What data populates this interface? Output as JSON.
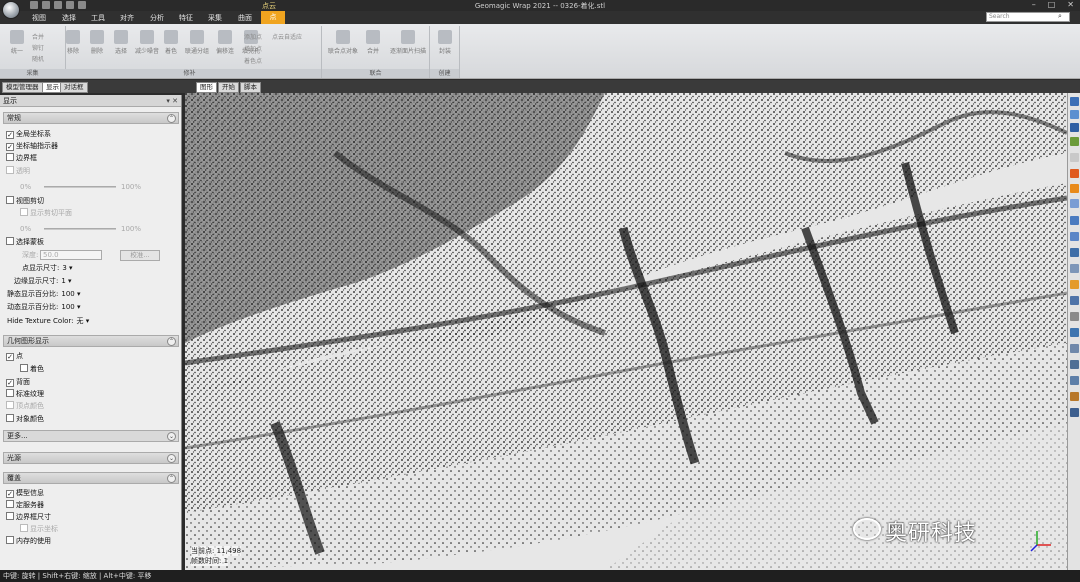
{
  "window": {
    "title": "Geomagic Wrap 2021 -- 0326-着化.stl",
    "context_tab_title": "点云"
  },
  "menu_tabs": [
    "视图",
    "选择",
    "工具",
    "对齐",
    "分析",
    "特征",
    "采集",
    "曲面"
  ],
  "active_tab": "点",
  "search": {
    "placeholder": "Search"
  },
  "ribbon": {
    "group1": {
      "label": "采集",
      "buttons": [
        "统一"
      ],
      "small": [
        "合并",
        "铆钉",
        "随机"
      ]
    },
    "group2": {
      "label": "修补",
      "buttons": [
        "移除",
        "删除",
        "选择",
        "减少噪音",
        "着色",
        "联通分组",
        "偏移连",
        "填充孔"
      ],
      "small": [
        "添加点",
        "增加点",
        "着色点",
        "投影方向",
        "点云自适应"
      ]
    },
    "group3": {
      "label": "联合",
      "buttons": [
        "联合点对象",
        "合并",
        "逐渐面片扫描"
      ]
    },
    "group4": {
      "label": "创建",
      "buttons": [
        "封装"
      ]
    }
  },
  "sub_tabs": [
    "模型管理器",
    "显示",
    "对话框"
  ],
  "viewport_tabs": [
    "图形",
    "开始",
    "脚本"
  ],
  "panel": {
    "title": "显示",
    "sections": {
      "general": {
        "title": "常规"
      },
      "geometry": {
        "title": "几何图形显示"
      },
      "lighting": {
        "title": "光源"
      },
      "overlay": {
        "title": "覆盖"
      }
    },
    "general_items": {
      "global_axes": "全局坐标系",
      "axis_indicator": "坐标轴指示器",
      "bounding_box": "边界框",
      "transparent": "透明",
      "pct_min": "0%",
      "pct_max": "100%",
      "view_clip": "视图剪切",
      "show_clip_plane": "显示剪切平面",
      "pct_min2": "0%",
      "pct_max2": "100%",
      "select_mask": "选择蒙板",
      "depth_label": "深度:",
      "depth_value": "50.0",
      "calibrate_btn": "校准...",
      "point_size_label": "点显示尺寸:",
      "point_size_value": "3",
      "edge_size_label": "边缘显示尺寸:",
      "edge_size_value": "1",
      "static_pct_label": "静态显示百分比:",
      "static_pct_value": "100",
      "dynamic_pct_label": "动态显示百分比:",
      "dynamic_pct_value": "100",
      "hide_texture_label": "Hide Texture Color:",
      "hide_texture_value": "无"
    },
    "geometry_items": {
      "points": "点",
      "coloring": "着色",
      "backface": "背面",
      "standard_texture": "标准纹理",
      "vertex_color": "顶点颜色",
      "object_color": "对象颜色",
      "more": "更多..."
    },
    "overlay_items": {
      "model_info": "模型信息",
      "server": "定服务器",
      "bbox_size": "边界框尺寸",
      "show_coords": "显示坐标",
      "memory_usage": "内存的使用"
    }
  },
  "viewport": {
    "info_line1": "当前点: 11,498",
    "info_line2": "帧数时间: 1",
    "watermark": "奥研科技"
  },
  "status_bar": {
    "text": "中键: 旋转 | Shift+右键: 缩放 | Alt+中键: 平移"
  },
  "colors": {
    "accent": "#f0a41f",
    "chrome_dark": "#2a2a2a",
    "ribbon_bg": "#e1e2e4",
    "panel_bg": "#eeeeee"
  }
}
